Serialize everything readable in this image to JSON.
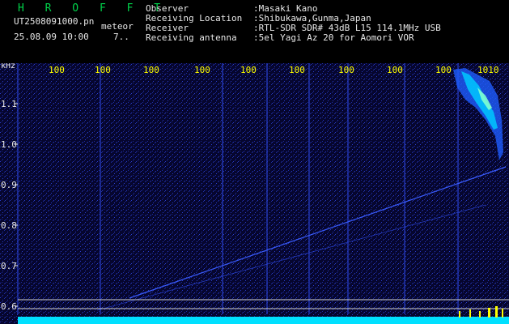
{
  "header": {
    "title": "H R O F F T",
    "filename": "UT2508091000.pn",
    "mode": "meteor",
    "datetime": "25.08.09 10:00",
    "count": "7..",
    "meta": [
      {
        "label": "Observer",
        "value": ":Masaki Kano"
      },
      {
        "label": "Receiving Location",
        "value": ":Shibukawa,Gunma,Japan"
      },
      {
        "label": "Receiver",
        "value": ":RTL-SDR SDR# 43dB L15 114.1MHz USB"
      },
      {
        "label": "Receiving antenna",
        "value": ":5el Yagi Az 20 for Aomori VOR"
      }
    ]
  },
  "spectrogram": {
    "y_unit": "kHz",
    "y_ticks": [
      "1.1",
      "1.0",
      "0.9",
      "0.8",
      "0.7",
      "0.6"
    ],
    "time_labels": [
      "100",
      "100",
      "100",
      "100",
      "100",
      "100",
      "100",
      "100",
      "100",
      "1010"
    ],
    "colors": {
      "background": "#06062e",
      "noise": "#2a3cc8",
      "signal": "#00e0ff",
      "label": "#ffff00",
      "axis": "#e8e8e8"
    }
  }
}
